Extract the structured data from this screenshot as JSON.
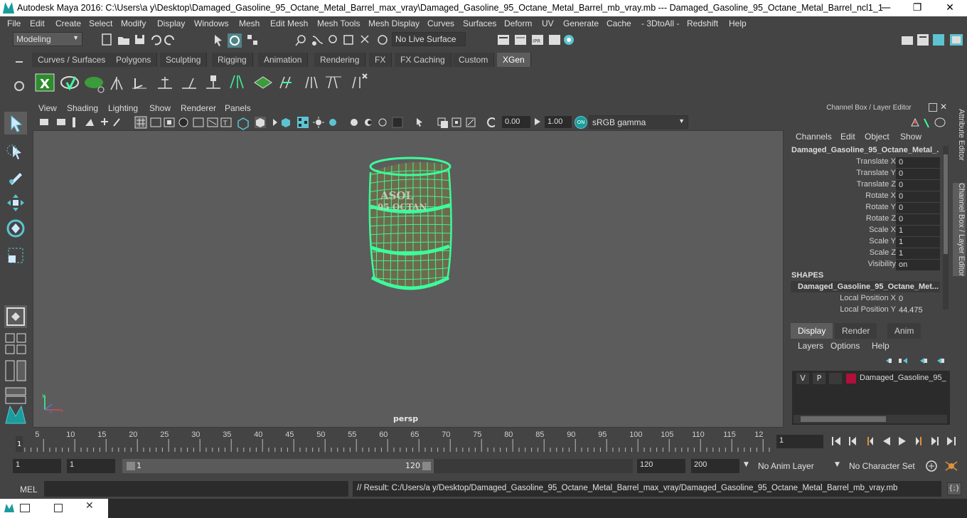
{
  "window": {
    "title": "Autodesk Maya 2016: C:\\Users\\a y\\Desktop\\Damaged_Gasoline_95_Octane_Metal_Barrel_max_vray\\Damaged_Gasoline_95_Octane_Metal_Barrel_mb_vray.mb   ---   Damaged_Gasoline_95_Octane_Metal_Barrel_ncl1_1",
    "minimize": "—",
    "restore": "❐",
    "close": "✕"
  },
  "menubar": [
    "File",
    "Edit",
    "Create",
    "Select",
    "Modify",
    "Display",
    "Windows",
    "Mesh",
    "Edit Mesh",
    "Mesh Tools",
    "Mesh Display",
    "Curves",
    "Surfaces",
    "Deform",
    "UV",
    "Generate",
    "Cache",
    "- 3DtoAll -",
    "Redshift",
    "Help"
  ],
  "statusline": {
    "mode": "Modeling",
    "live_surface": "No Live Surface"
  },
  "shelf_tabs": [
    {
      "label": "Curves / Surfaces",
      "active": false
    },
    {
      "label": "Polygons",
      "active": false
    },
    {
      "label": "Sculpting",
      "active": false
    },
    {
      "label": "Rigging",
      "active": false
    },
    {
      "label": "Animation",
      "active": false
    },
    {
      "label": "Rendering",
      "active": false
    },
    {
      "label": "FX",
      "active": false
    },
    {
      "label": "FX Caching",
      "active": false
    },
    {
      "label": "Custom",
      "active": false
    },
    {
      "label": "XGen",
      "active": true
    }
  ],
  "viewport": {
    "menu": [
      "View",
      "Shading",
      "Lighting",
      "Show",
      "Renderer",
      "Panels"
    ],
    "exposure": "0.00",
    "gamma": "1.00",
    "color_space": "sRGB gamma",
    "camera": "persp",
    "barrel_text_1": "ASOL",
    "barrel_text_2": "95 OCTAN"
  },
  "channel_box": {
    "header": "Channel Box / Layer Editor",
    "menu": [
      "Channels",
      "Edit",
      "Object",
      "Show"
    ],
    "object_name": "Damaged_Gasoline_95_Octane_Metal_...",
    "attributes": [
      {
        "label": "Translate X",
        "value": "0"
      },
      {
        "label": "Translate Y",
        "value": "0"
      },
      {
        "label": "Translate Z",
        "value": "0"
      },
      {
        "label": "Rotate X",
        "value": "0"
      },
      {
        "label": "Rotate Y",
        "value": "0"
      },
      {
        "label": "Rotate Z",
        "value": "0"
      },
      {
        "label": "Scale X",
        "value": "1"
      },
      {
        "label": "Scale Y",
        "value": "1"
      },
      {
        "label": "Scale Z",
        "value": "1"
      },
      {
        "label": "Visibility",
        "value": "on"
      }
    ],
    "shapes_title": "SHAPES",
    "shape_name": "Damaged_Gasoline_95_Octane_Met...",
    "shape_attributes": [
      {
        "label": "Local Position X",
        "value": "0"
      },
      {
        "label": "Local Position Y",
        "value": "44.475"
      }
    ],
    "layer_tabs": [
      {
        "label": "Display",
        "active": true
      },
      {
        "label": "Render",
        "active": false
      },
      {
        "label": "Anim",
        "active": false
      }
    ],
    "layer_menu": [
      "Layers",
      "Options",
      "Help"
    ],
    "layer": {
      "v": "V",
      "p": "P",
      "name": "Damaged_Gasoline_95_O",
      "color": "#b0103a"
    }
  },
  "side_tabs": [
    "Attribute Editor",
    "Channel Box / Layer Editor"
  ],
  "timeline": {
    "ticks": [
      "5",
      "10",
      "15",
      "20",
      "25",
      "30",
      "35",
      "40",
      "45",
      "50",
      "55",
      "60",
      "65",
      "70",
      "75",
      "80",
      "85",
      "90",
      "95",
      "100",
      "105",
      "110",
      "115",
      "12"
    ],
    "start_marker": "1",
    "current_frame": "1"
  },
  "range": {
    "start": "1",
    "playback_start": "1",
    "slider_start": "1",
    "slider_end": "120",
    "playback_end": "120",
    "end": "200",
    "anim_layer": "No Anim Layer",
    "character_set": "No Character Set"
  },
  "command": {
    "label": "MEL",
    "result": "// Result: C:/Users/a y/Desktop/Damaged_Gasoline_95_Octane_Metal_Barrel_max_vray/Damaged_Gasoline_95_Octane_Metal_Barrel_mb_vray.mb"
  },
  "colors": {
    "accent": "#5dc3d0",
    "wireframe": "#3dfa9c",
    "active_tab": "#5d5d5d"
  }
}
